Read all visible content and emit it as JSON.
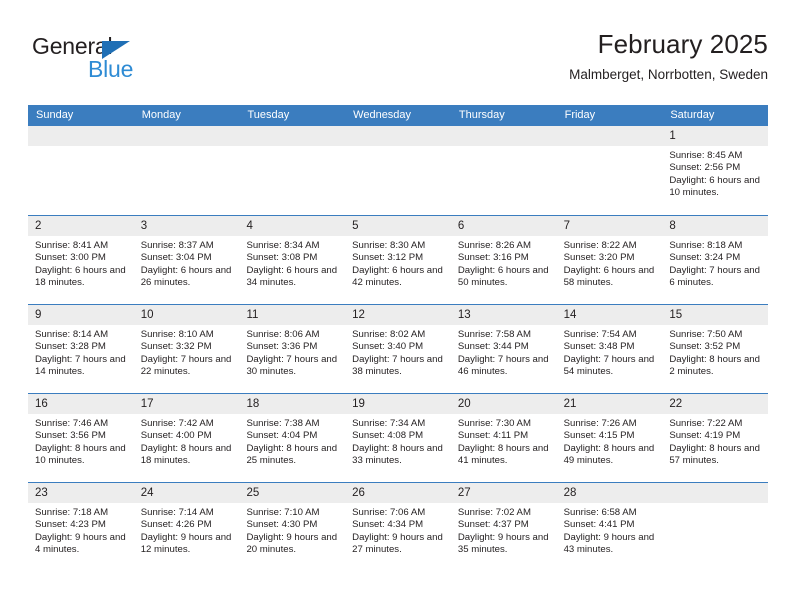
{
  "brand": {
    "name_primary": "General",
    "name_secondary": "Blue",
    "triangle_color": "#1f6fb5",
    "secondary_color": "#2e8bd4"
  },
  "header": {
    "title": "February 2025",
    "subtitle": "Malmberget, Norrbotten, Sweden"
  },
  "theme": {
    "header_blue": "#3b7dbf",
    "daynum_bar": "#ededed",
    "text": "#231f20"
  },
  "weekdays": [
    "Sunday",
    "Monday",
    "Tuesday",
    "Wednesday",
    "Thursday",
    "Friday",
    "Saturday"
  ],
  "weeks": [
    [
      {
        "empty": true
      },
      {
        "empty": true
      },
      {
        "empty": true
      },
      {
        "empty": true
      },
      {
        "empty": true
      },
      {
        "empty": true
      },
      {
        "day": "1",
        "sunrise": "Sunrise: 8:45 AM",
        "sunset": "Sunset: 2:56 PM",
        "daylight": "Daylight: 6 hours and 10 minutes."
      }
    ],
    [
      {
        "day": "2",
        "sunrise": "Sunrise: 8:41 AM",
        "sunset": "Sunset: 3:00 PM",
        "daylight": "Daylight: 6 hours and 18 minutes."
      },
      {
        "day": "3",
        "sunrise": "Sunrise: 8:37 AM",
        "sunset": "Sunset: 3:04 PM",
        "daylight": "Daylight: 6 hours and 26 minutes."
      },
      {
        "day": "4",
        "sunrise": "Sunrise: 8:34 AM",
        "sunset": "Sunset: 3:08 PM",
        "daylight": "Daylight: 6 hours and 34 minutes."
      },
      {
        "day": "5",
        "sunrise": "Sunrise: 8:30 AM",
        "sunset": "Sunset: 3:12 PM",
        "daylight": "Daylight: 6 hours and 42 minutes."
      },
      {
        "day": "6",
        "sunrise": "Sunrise: 8:26 AM",
        "sunset": "Sunset: 3:16 PM",
        "daylight": "Daylight: 6 hours and 50 minutes."
      },
      {
        "day": "7",
        "sunrise": "Sunrise: 8:22 AM",
        "sunset": "Sunset: 3:20 PM",
        "daylight": "Daylight: 6 hours and 58 minutes."
      },
      {
        "day": "8",
        "sunrise": "Sunrise: 8:18 AM",
        "sunset": "Sunset: 3:24 PM",
        "daylight": "Daylight: 7 hours and 6 minutes."
      }
    ],
    [
      {
        "day": "9",
        "sunrise": "Sunrise: 8:14 AM",
        "sunset": "Sunset: 3:28 PM",
        "daylight": "Daylight: 7 hours and 14 minutes."
      },
      {
        "day": "10",
        "sunrise": "Sunrise: 8:10 AM",
        "sunset": "Sunset: 3:32 PM",
        "daylight": "Daylight: 7 hours and 22 minutes."
      },
      {
        "day": "11",
        "sunrise": "Sunrise: 8:06 AM",
        "sunset": "Sunset: 3:36 PM",
        "daylight": "Daylight: 7 hours and 30 minutes."
      },
      {
        "day": "12",
        "sunrise": "Sunrise: 8:02 AM",
        "sunset": "Sunset: 3:40 PM",
        "daylight": "Daylight: 7 hours and 38 minutes."
      },
      {
        "day": "13",
        "sunrise": "Sunrise: 7:58 AM",
        "sunset": "Sunset: 3:44 PM",
        "daylight": "Daylight: 7 hours and 46 minutes."
      },
      {
        "day": "14",
        "sunrise": "Sunrise: 7:54 AM",
        "sunset": "Sunset: 3:48 PM",
        "daylight": "Daylight: 7 hours and 54 minutes."
      },
      {
        "day": "15",
        "sunrise": "Sunrise: 7:50 AM",
        "sunset": "Sunset: 3:52 PM",
        "daylight": "Daylight: 8 hours and 2 minutes."
      }
    ],
    [
      {
        "day": "16",
        "sunrise": "Sunrise: 7:46 AM",
        "sunset": "Sunset: 3:56 PM",
        "daylight": "Daylight: 8 hours and 10 minutes."
      },
      {
        "day": "17",
        "sunrise": "Sunrise: 7:42 AM",
        "sunset": "Sunset: 4:00 PM",
        "daylight": "Daylight: 8 hours and 18 minutes."
      },
      {
        "day": "18",
        "sunrise": "Sunrise: 7:38 AM",
        "sunset": "Sunset: 4:04 PM",
        "daylight": "Daylight: 8 hours and 25 minutes."
      },
      {
        "day": "19",
        "sunrise": "Sunrise: 7:34 AM",
        "sunset": "Sunset: 4:08 PM",
        "daylight": "Daylight: 8 hours and 33 minutes."
      },
      {
        "day": "20",
        "sunrise": "Sunrise: 7:30 AM",
        "sunset": "Sunset: 4:11 PM",
        "daylight": "Daylight: 8 hours and 41 minutes."
      },
      {
        "day": "21",
        "sunrise": "Sunrise: 7:26 AM",
        "sunset": "Sunset: 4:15 PM",
        "daylight": "Daylight: 8 hours and 49 minutes."
      },
      {
        "day": "22",
        "sunrise": "Sunrise: 7:22 AM",
        "sunset": "Sunset: 4:19 PM",
        "daylight": "Daylight: 8 hours and 57 minutes."
      }
    ],
    [
      {
        "day": "23",
        "sunrise": "Sunrise: 7:18 AM",
        "sunset": "Sunset: 4:23 PM",
        "daylight": "Daylight: 9 hours and 4 minutes."
      },
      {
        "day": "24",
        "sunrise": "Sunrise: 7:14 AM",
        "sunset": "Sunset: 4:26 PM",
        "daylight": "Daylight: 9 hours and 12 minutes."
      },
      {
        "day": "25",
        "sunrise": "Sunrise: 7:10 AM",
        "sunset": "Sunset: 4:30 PM",
        "daylight": "Daylight: 9 hours and 20 minutes."
      },
      {
        "day": "26",
        "sunrise": "Sunrise: 7:06 AM",
        "sunset": "Sunset: 4:34 PM",
        "daylight": "Daylight: 9 hours and 27 minutes."
      },
      {
        "day": "27",
        "sunrise": "Sunrise: 7:02 AM",
        "sunset": "Sunset: 4:37 PM",
        "daylight": "Daylight: 9 hours and 35 minutes."
      },
      {
        "day": "28",
        "sunrise": "Sunrise: 6:58 AM",
        "sunset": "Sunset: 4:41 PM",
        "daylight": "Daylight: 9 hours and 43 minutes."
      },
      {
        "empty": true
      }
    ]
  ]
}
